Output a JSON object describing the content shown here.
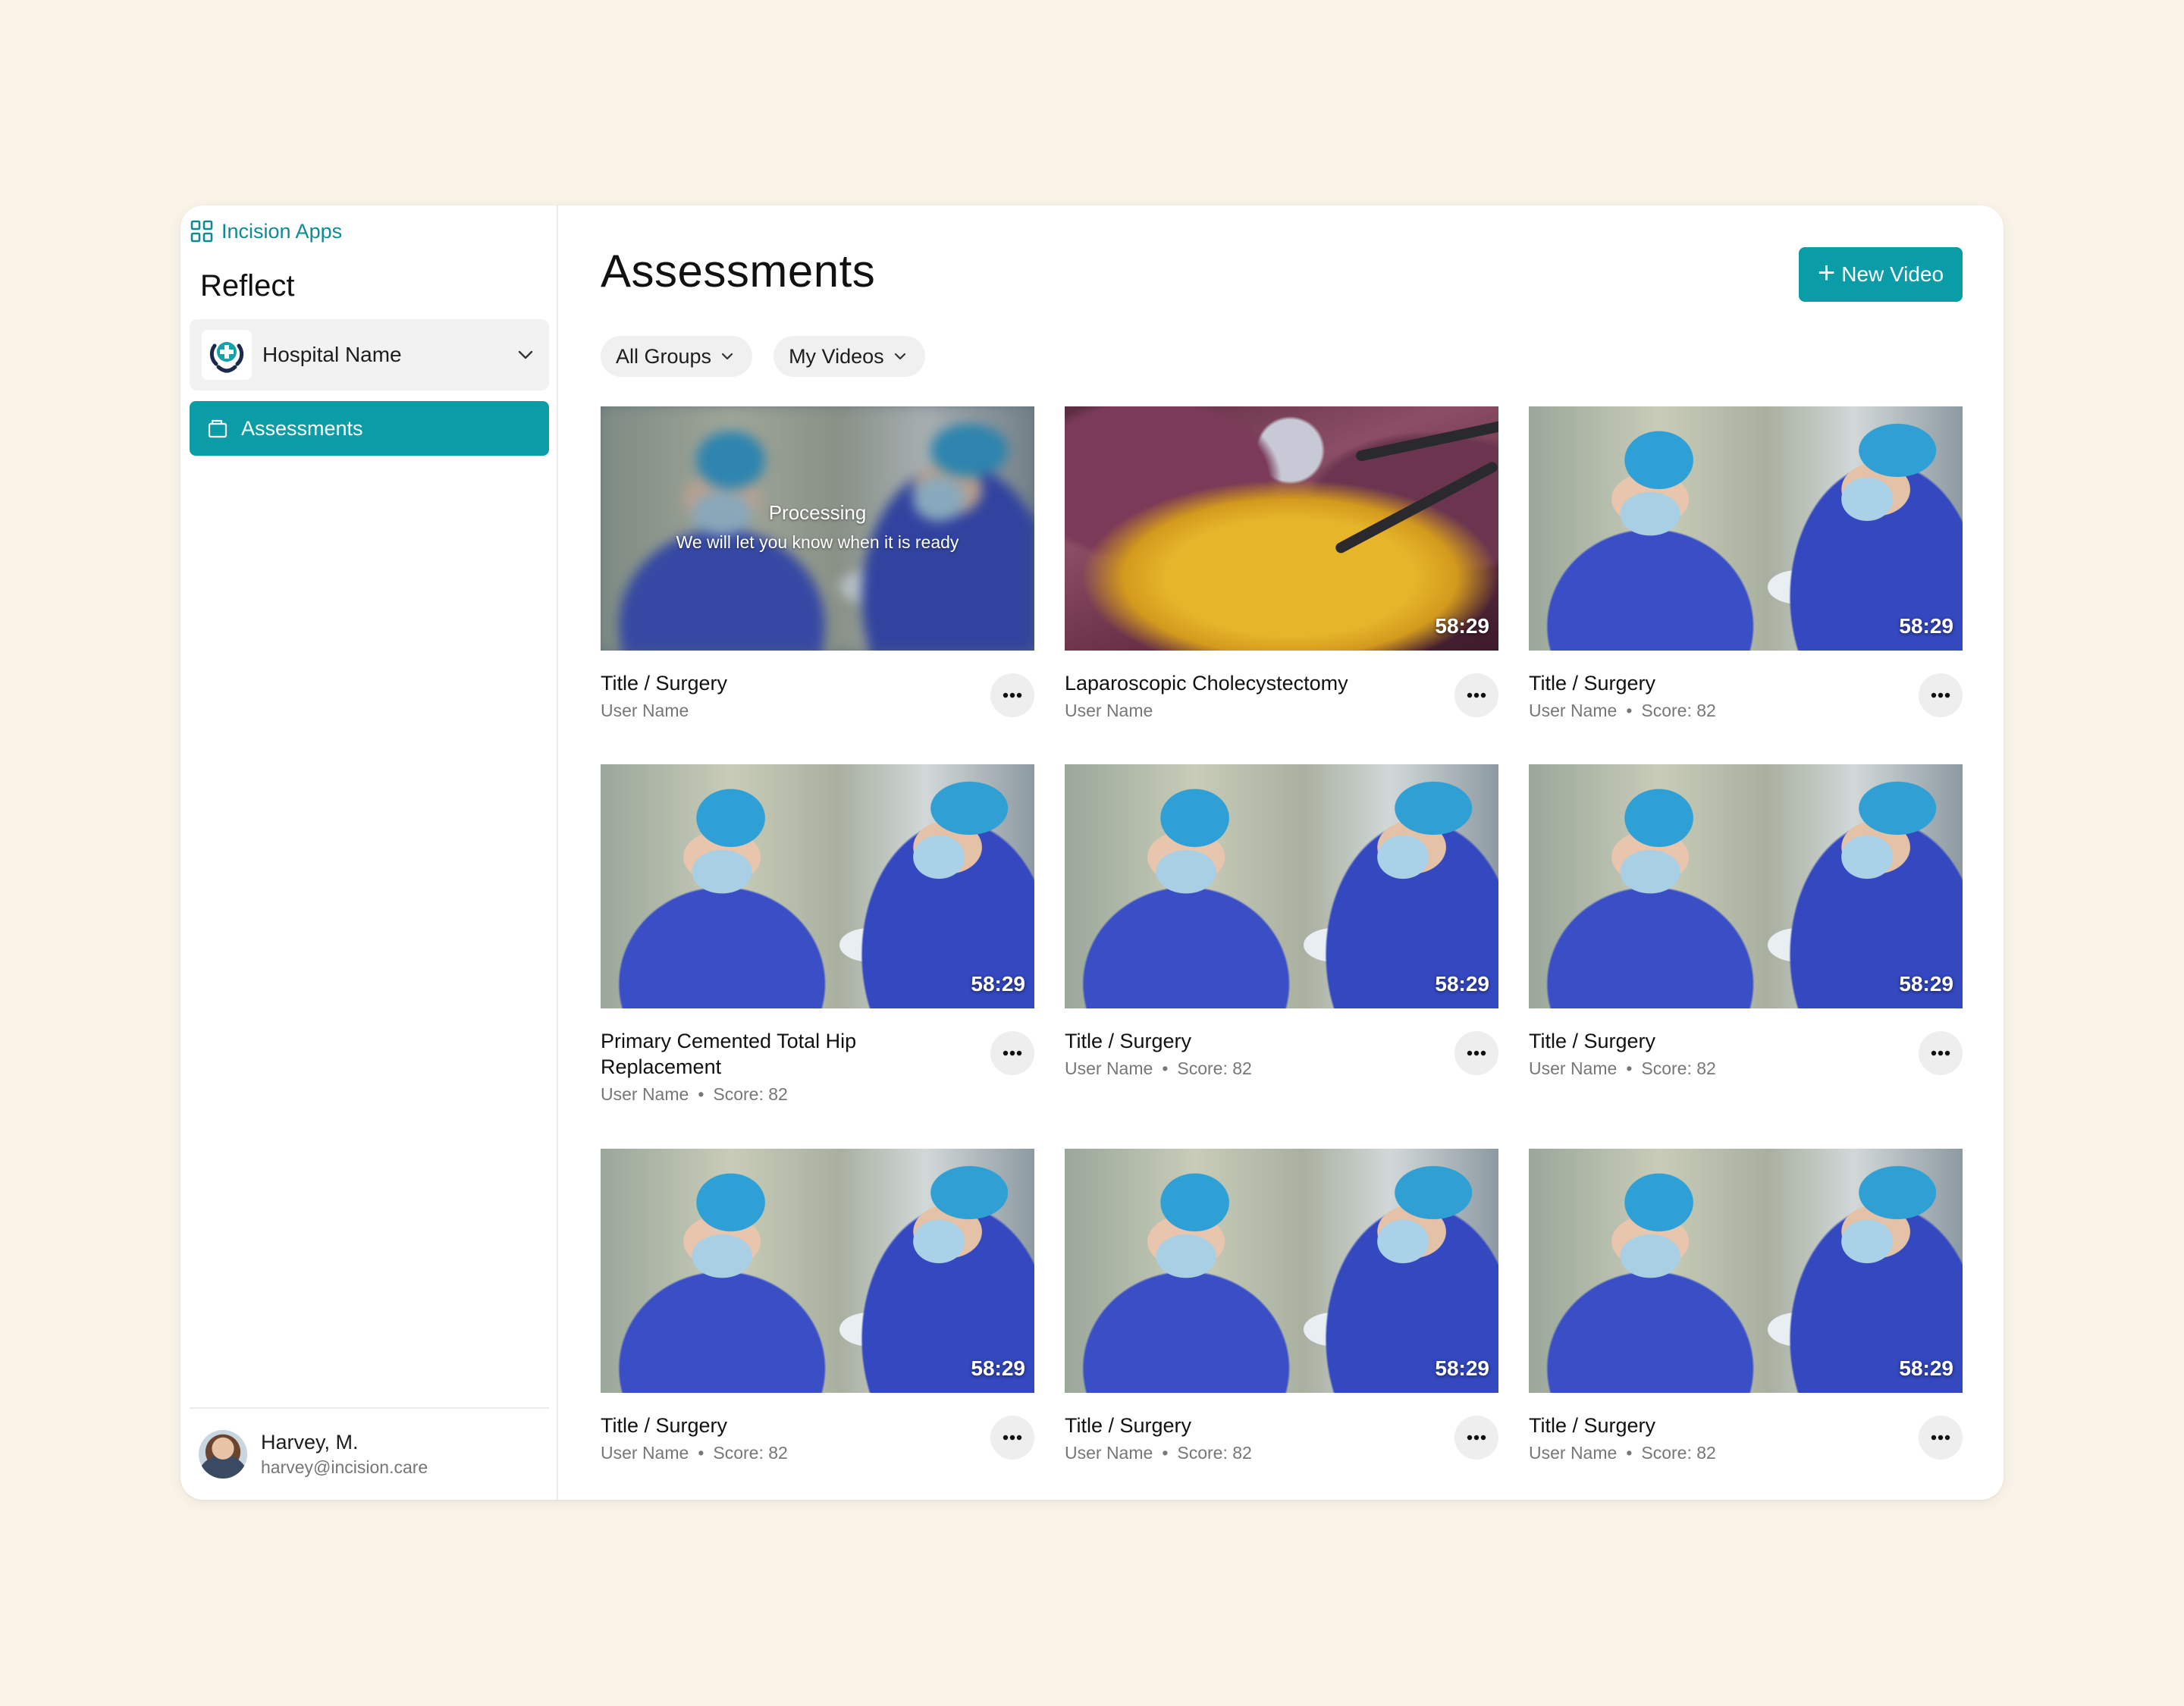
{
  "sidebar": {
    "apps_link": "Incision Apps",
    "app_title": "Reflect",
    "hospital": {
      "name": "Hospital Name"
    },
    "nav": [
      {
        "label": "Assessments"
      }
    ],
    "user": {
      "name": "Harvey, M.",
      "email": "harvey@incision.care"
    }
  },
  "main": {
    "title": "Assessments",
    "new_video_label": "New Video",
    "filters": [
      {
        "label": "All Groups"
      },
      {
        "label": "My Videos"
      }
    ],
    "processing": {
      "title": "Processing",
      "subtitle": "We will let you know when it is ready"
    },
    "separator": "•",
    "cards": [
      {
        "title": "Title / Surgery",
        "user": "User Name",
        "score": "",
        "duration": "",
        "thumb": "processing"
      },
      {
        "title": "Laparoscopic Cholecystectomy",
        "user": "User Name",
        "score": "",
        "duration": "58:29",
        "thumb": "lapa"
      },
      {
        "title": "Title / Surgery",
        "user": "User Name",
        "score": "Score: 82",
        "duration": "58:29",
        "thumb": "surgeons"
      },
      {
        "title": "Primary Cemented Total Hip Replacement",
        "user": "User Name",
        "score": "Score: 82",
        "duration": "58:29",
        "thumb": "surgeons"
      },
      {
        "title": "Title / Surgery",
        "user": "User Name",
        "score": "Score: 82",
        "duration": "58:29",
        "thumb": "surgeons"
      },
      {
        "title": "Title / Surgery",
        "user": "User Name",
        "score": "Score: 82",
        "duration": "58:29",
        "thumb": "surgeons"
      },
      {
        "title": "Title / Surgery",
        "user": "User Name",
        "score": "Score: 82",
        "duration": "58:29",
        "thumb": "surgeons"
      },
      {
        "title": "Title / Surgery",
        "user": "User Name",
        "score": "Score: 82",
        "duration": "58:29",
        "thumb": "surgeons"
      },
      {
        "title": "Title / Surgery",
        "user": "User Name",
        "score": "Score: 82",
        "duration": "58:29",
        "thumb": "surgeons"
      }
    ]
  },
  "colors": {
    "accent": "#0a9da8",
    "link": "#0e8a96",
    "background": "#faf3e8"
  },
  "icons": {
    "apps": "grid-icon",
    "hospital": "hospital-logo-icon",
    "dropdown": "chevron-down-icon",
    "assessments": "folder-icon",
    "new": "plus-icon",
    "more": "more-horizontal-icon"
  }
}
